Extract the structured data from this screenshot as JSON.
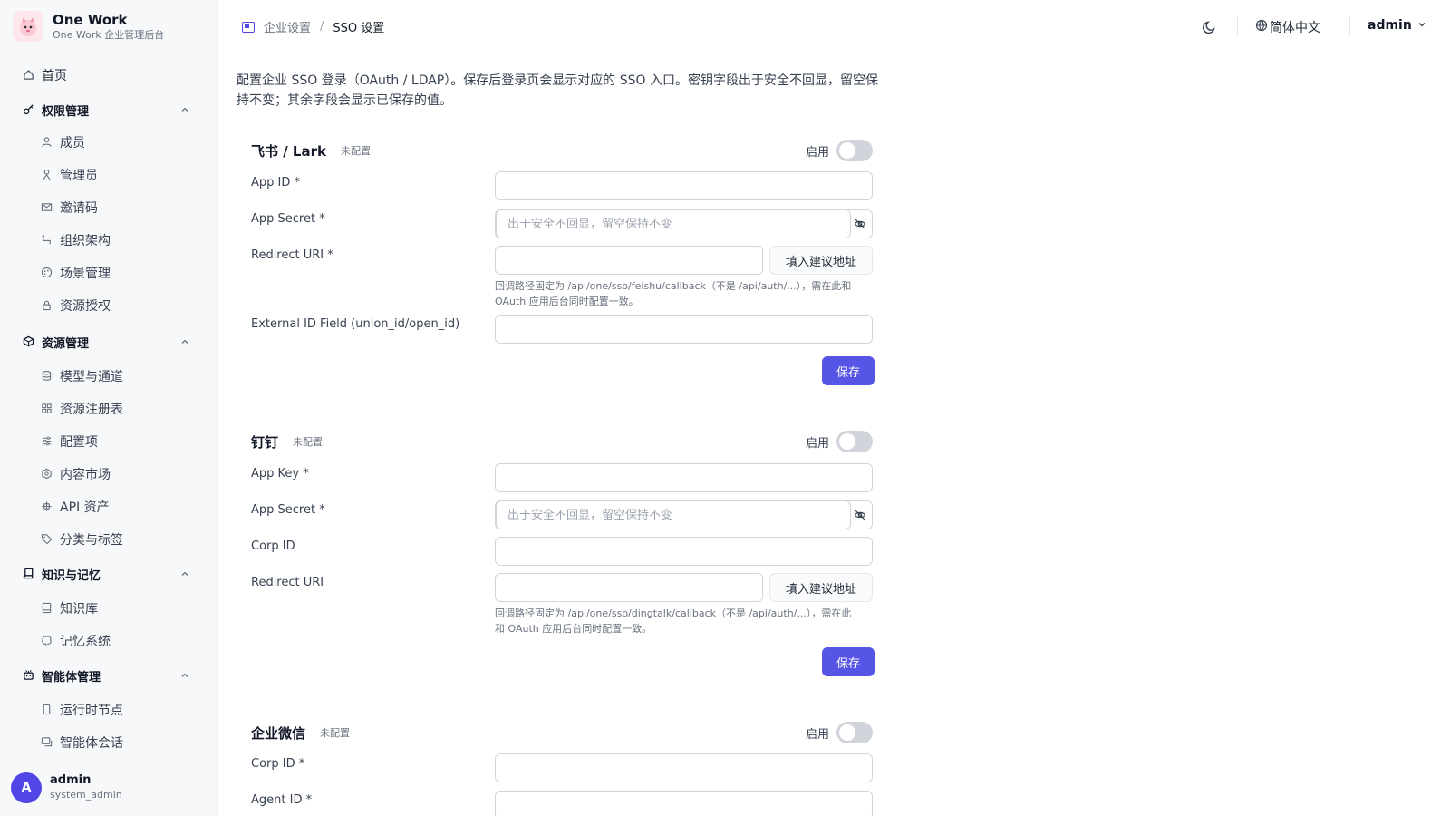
{
  "brand": {
    "title": "One Work",
    "subtitle": "One Work 企业管理后台"
  },
  "sidebar": {
    "home": "首页",
    "groups": [
      {
        "label": "权限管理",
        "items": [
          "成员",
          "管理员",
          "邀请码",
          "组织架构",
          "场景管理",
          "资源授权"
        ]
      },
      {
        "label": "资源管理",
        "items": [
          "模型与通道",
          "资源注册表",
          "配置项",
          "内容市场",
          "API 资产",
          "分类与标签"
        ]
      },
      {
        "label": "知识与记忆",
        "items": [
          "知识库",
          "记忆系统"
        ]
      },
      {
        "label": "智能体管理",
        "items": [
          "运行时节点",
          "智能体会话"
        ]
      }
    ]
  },
  "user": {
    "avatar": "A",
    "name": "admin",
    "role": "system_admin"
  },
  "header": {
    "breadcrumb": [
      "企业设置",
      "SSO 设置"
    ],
    "breadcrumb_sep": "/",
    "language": "简体中文",
    "account": "admin"
  },
  "intro": "配置企业 SSO 登录（OAuth / LDAP）。保存后登录页会显示对应的 SSO 入口。密钥字段出于安全不回显，留空保持不变；其余字段会显示已保存的值。",
  "sections": [
    {
      "title": "飞书 / Lark",
      "badge": "未配置",
      "enable_label": "启用",
      "fields": {
        "app_id": "App ID *",
        "app_secret": "App Secret *",
        "secret_placeholder": "出于安全不回显，留空保持不变",
        "redirect": "Redirect URI *",
        "suggest": "填入建议地址",
        "hint": "回调路径固定为 /api/one/sso/feishu/callback（不是 /api/auth/...），需在此和 OAuth 应用后台同时配置一致。",
        "external_id": "External ID Field (union_id/open_id)"
      },
      "save": "保存"
    },
    {
      "title": "钉钉",
      "badge": "未配置",
      "enable_label": "启用",
      "fields": {
        "app_key": "App Key *",
        "app_secret": "App Secret *",
        "secret_placeholder": "出于安全不回显，留空保持不变",
        "corp_id": "Corp ID",
        "redirect": "Redirect URI",
        "suggest": "填入建议地址",
        "hint": "回调路径固定为 /api/one/sso/dingtalk/callback（不是 /api/auth/...），需在此和 OAuth 应用后台同时配置一致。"
      },
      "save": "保存"
    },
    {
      "title": "企业微信",
      "badge": "未配置",
      "enable_label": "启用",
      "fields": {
        "corp_id": "Corp ID *",
        "agent_id": "Agent ID *"
      }
    }
  ],
  "colors": {
    "accent": "#5755e6",
    "sidebar_bg": "#f7f8fa",
    "toggle_off": "#d1d5db"
  }
}
